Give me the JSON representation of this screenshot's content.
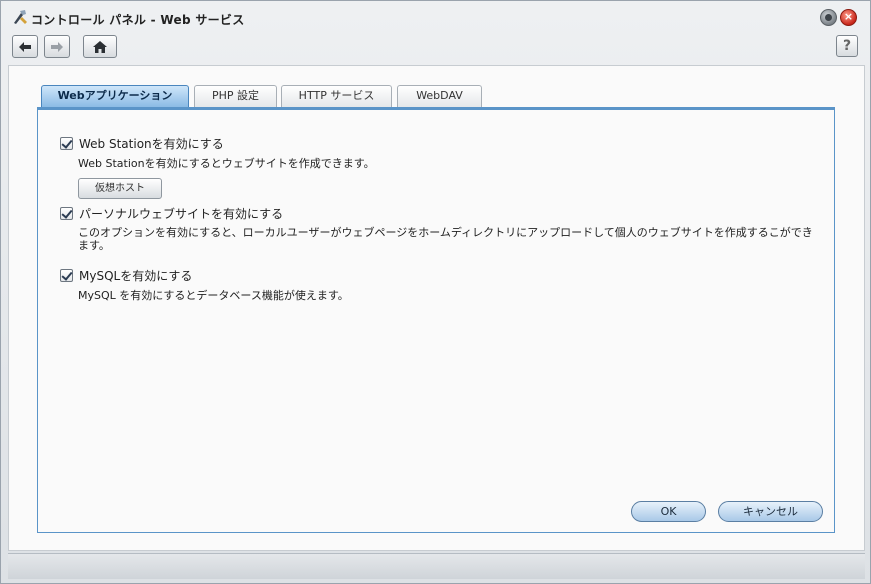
{
  "window": {
    "title": "コントロール パネル - Web サービス"
  },
  "toolbar": {
    "help_label": "?"
  },
  "tabs": [
    {
      "label": "Webアプリケーション",
      "active": true
    },
    {
      "label": "PHP 設定",
      "active": false
    },
    {
      "label": "HTTP サービス",
      "active": false
    },
    {
      "label": "WebDAV",
      "active": false
    }
  ],
  "options": {
    "web_station": {
      "label": "Web Stationを有効にする",
      "checked": true,
      "description": "Web Stationを有効にするとウェブサイトを作成できます。",
      "button_label": "仮想ホスト"
    },
    "personal_site": {
      "label": "パーソナルウェブサイトを有効にする",
      "checked": true,
      "description": "このオプションを有効にすると、ローカルユーザーがウェブページをホームディレクトリにアップロードして個人のウェブサイトを作成するこができます。"
    },
    "mysql": {
      "label": "MySQLを有効にする",
      "checked": true,
      "description": "MySQL を有効にするとデータベース機能が使えます。"
    }
  },
  "actions": {
    "ok_label": "OK",
    "cancel_label": "キャンセル"
  },
  "colors": {
    "accent": "#5a94c8",
    "close": "#c8261a"
  }
}
